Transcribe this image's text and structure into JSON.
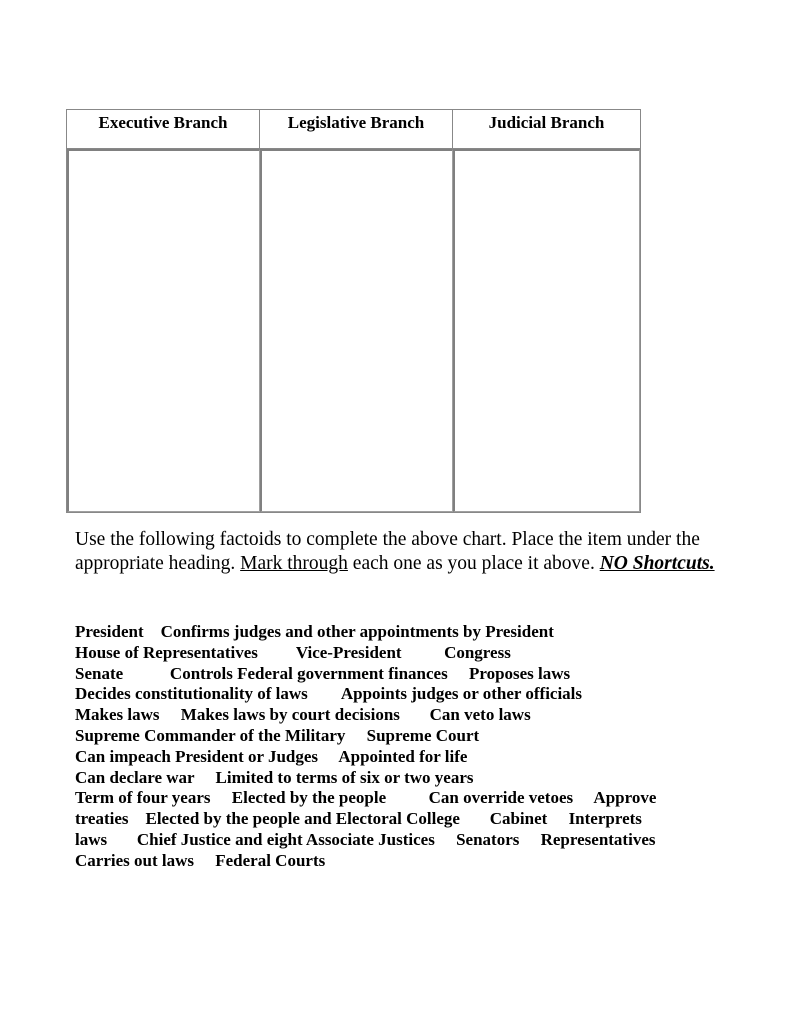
{
  "table": {
    "headers": [
      "Executive Branch",
      "Legislative Branch",
      "Judicial Branch"
    ],
    "cells": [
      "",
      "",
      ""
    ]
  },
  "instructions": {
    "part1": "Use the following factoids to complete the above chart.  Place the item under the appropriate heading.  ",
    "underlined": "Mark through",
    "part2": " each one as you place it above. ",
    "emphasis": "NO Shortcuts."
  },
  "factoid_lines": [
    "President    Confirms judges and other appointments by President",
    "House of Representatives         Vice-President          Congress",
    "Senate           Controls Federal government finances     Proposes laws",
    "Decides constitutionality of laws        Appoints judges or other officials",
    "Makes laws     Makes laws by court decisions       Can veto laws",
    "Supreme Commander of the Military     Supreme Court",
    "Can impeach President or Judges     Appointed for life",
    "Can declare war     Limited to terms of six or two years",
    "Term of four years     Elected by the people          Can override vetoes     Approve",
    "treaties    Elected by the people and Electoral College       Cabinet     Interprets",
    "laws       Chief Justice and eight Associate Justices     Senators     Representatives",
    "Carries out laws     Federal Courts"
  ]
}
